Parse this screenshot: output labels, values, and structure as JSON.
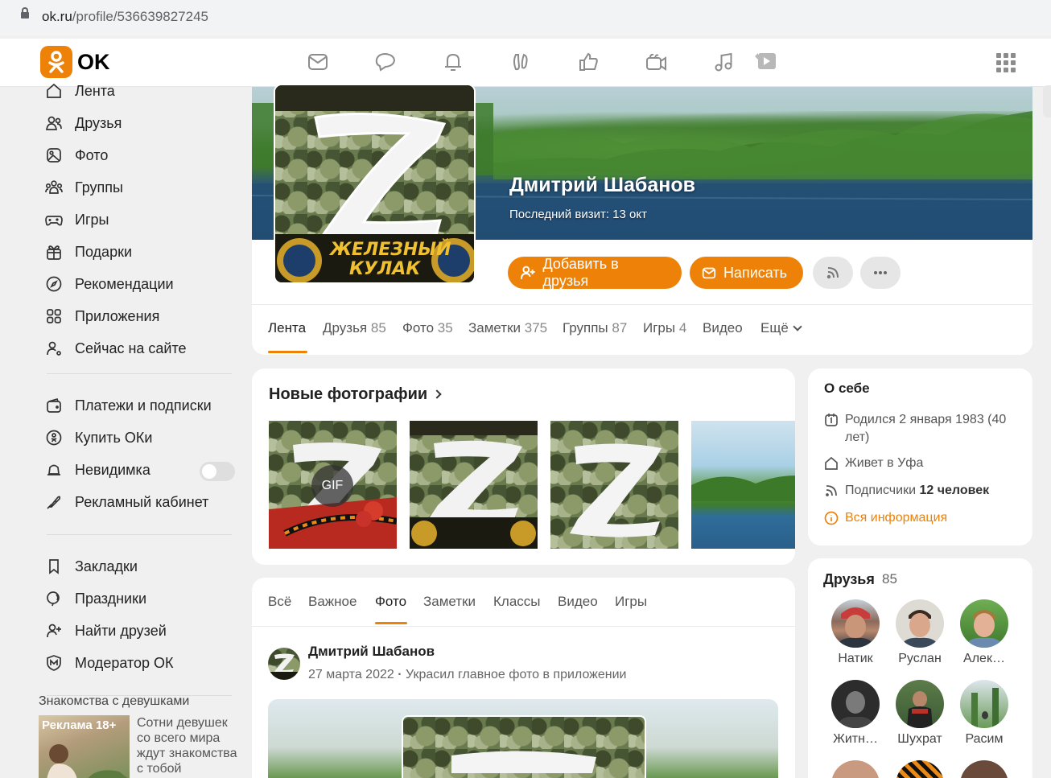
{
  "browser": {
    "url_host": "ok.ru",
    "url_path": "/profile/536639827245"
  },
  "nav": {
    "logo_text": "OK",
    "icons": [
      "messages-icon",
      "discussions-icon",
      "notifications-icon",
      "guests-icon",
      "ratings-icon",
      "video-icon",
      "music-icon",
      "video-play-icon"
    ]
  },
  "sidebar": {
    "items": [
      {
        "label": "Лента",
        "icon": "feed-icon"
      },
      {
        "label": "Друзья",
        "icon": "friends-icon"
      },
      {
        "label": "Фото",
        "icon": "photo-icon"
      },
      {
        "label": "Группы",
        "icon": "groups-icon"
      },
      {
        "label": "Игры",
        "icon": "games-icon"
      },
      {
        "label": "Подарки",
        "icon": "gift-icon"
      },
      {
        "label": "Рекомендации",
        "icon": "compass-icon"
      },
      {
        "label": "Приложения",
        "icon": "apps-icon"
      },
      {
        "label": "Сейчас на сайте",
        "icon": "online-icon"
      }
    ],
    "items2": [
      {
        "label": "Платежи и подписки",
        "icon": "wallet-icon"
      },
      {
        "label": "Купить ОКи",
        "icon": "coin-icon"
      },
      {
        "label": "Невидимка",
        "icon": "invisible-icon"
      },
      {
        "label": "Рекламный кабинет",
        "icon": "ads-icon"
      }
    ],
    "items3": [
      {
        "label": "Закладки",
        "icon": "bookmark-icon"
      },
      {
        "label": "Праздники",
        "icon": "holiday-icon"
      },
      {
        "label": "Найти друзей",
        "icon": "add-friend-icon"
      },
      {
        "label": "Модератор ОК",
        "icon": "moderator-icon"
      }
    ],
    "ad": {
      "title": "Знакомства с девушками",
      "badge": "Реклама 18+",
      "text": "Сотни девушек со всего мира ждут знакомства с тобой"
    }
  },
  "profile": {
    "name": "Дмитрий Шабанов",
    "last_visit": "Последний визит: 13 окт",
    "avatar_caption_line1": "ЖЕЛЕЗНЫЙ",
    "avatar_caption_line2": "КУЛАК",
    "add_friend": "Добавить в друзья",
    "write": "Написать",
    "tabs": [
      {
        "label": "Лента",
        "count": ""
      },
      {
        "label": "Друзья",
        "count": "85"
      },
      {
        "label": "Фото",
        "count": "35"
      },
      {
        "label": "Заметки",
        "count": "375"
      },
      {
        "label": "Группы",
        "count": "87"
      },
      {
        "label": "Игры",
        "count": "4"
      },
      {
        "label": "Видео",
        "count": ""
      },
      {
        "label": "Ещё",
        "count": ""
      }
    ]
  },
  "photos": {
    "title": "Новые фотографии",
    "gif": "GIF"
  },
  "about": {
    "title": "О себе",
    "born": "Родился 2 января 1983 (40 лет)",
    "lives_prefix": "Живет в",
    "lives_city": "Уфа",
    "subs_prefix": "Подписчики",
    "subs_value": "12 человек",
    "all_info": "Вся информация"
  },
  "friends": {
    "title": "Друзья",
    "count": "85",
    "list": [
      "Натик",
      "Руслан",
      "Алек…",
      "Житн…",
      "Шухрат",
      "Расим"
    ]
  },
  "feed": {
    "tabs": [
      "Всё",
      "Важное",
      "Фото",
      "Заметки",
      "Классы",
      "Видео",
      "Игры"
    ],
    "author": "Дмитрий Шабанов",
    "date": "27 марта 2022",
    "action": "Украсил главное фото в приложении"
  },
  "colors": {
    "accent": "#ee8208"
  }
}
